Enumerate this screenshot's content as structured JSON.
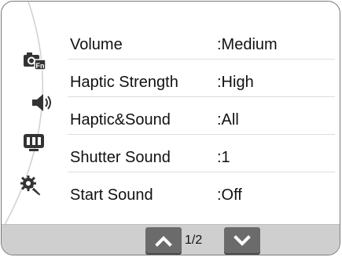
{
  "settings": [
    {
      "label": "Volume",
      "value": ":Medium"
    },
    {
      "label": "Haptic Strength",
      "value": ":High"
    },
    {
      "label": "Haptic&Sound",
      "value": ":All"
    },
    {
      "label": "Shutter Sound",
      "value": ":1"
    },
    {
      "label": "Start Sound",
      "value": ":Off"
    }
  ],
  "sidebar": {
    "icons": [
      "camera-fn-icon",
      "speaker-icon",
      "display-icon",
      "gear-wrench-icon"
    ]
  },
  "footer": {
    "page_indicator": "1/2"
  },
  "colors": {
    "footer_bg": "#cfcfcf",
    "button_bg": "#6b6b6b"
  }
}
